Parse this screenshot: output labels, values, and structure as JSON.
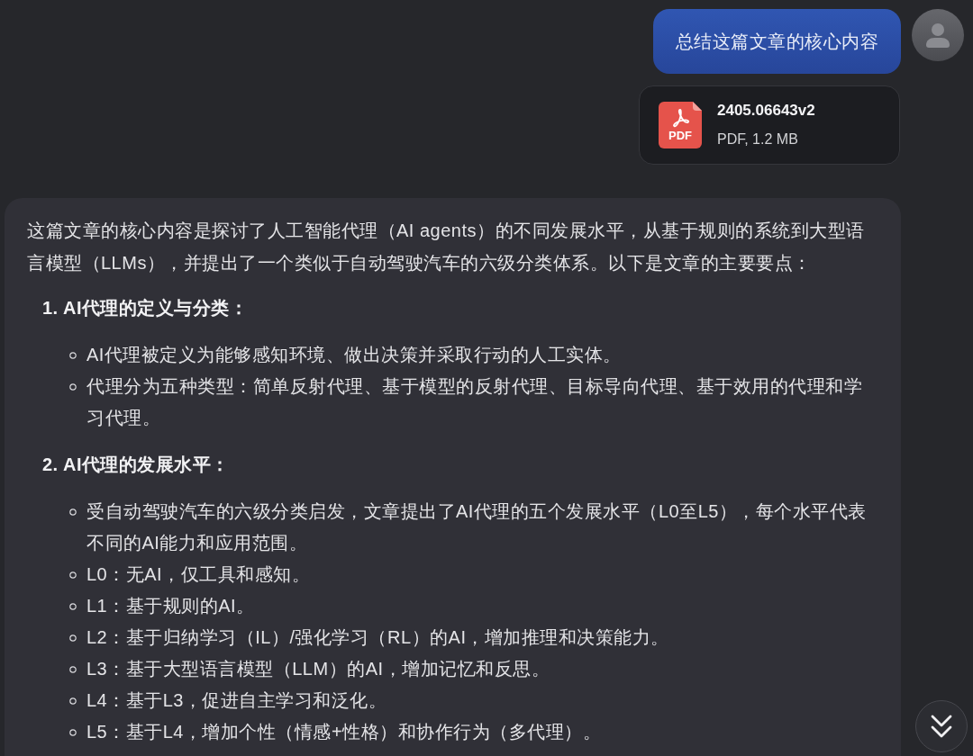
{
  "user_message": {
    "text": "总结这篇文章的核心内容"
  },
  "attachment": {
    "file_type_label": "PDF",
    "file_name": "2405.06643v2",
    "file_meta": "PDF, 1.2 MB"
  },
  "assistant_message": {
    "intro": "这篇文章的核心内容是探讨了人工智能代理（AI agents）的不同发展水平，从基于规则的系统到大型语言模型（LLMs），并提出了一个类似于自动驾驶汽车的六级分类体系。以下是文章的主要要点：",
    "sections": [
      {
        "heading": "1. AI代理的定义与分类：",
        "bullets": [
          "AI代理被定义为能够感知环境、做出决策并采取行动的人工实体。",
          "代理分为五种类型：简单反射代理、基于模型的反射代理、目标导向代理、基于效用的代理和学习代理。"
        ]
      },
      {
        "heading": "2. AI代理的发展水平：",
        "bullets": [
          "受自动驾驶汽车的六级分类启发，文章提出了AI代理的五个发展水平（L0至L5），每个水平代表不同的AI能力和应用范围。",
          "L0：无AI，仅工具和感知。",
          "L1：基于规则的AI。",
          "L2：基于归纳学习（IL）/强化学习（RL）的AI，增加推理和决策能力。",
          "L3：基于大型语言模型（LLM）的AI，增加记忆和反思。",
          "L4：基于L3，促进自主学习和泛化。",
          "L5：基于L4，增加个性（情感+性格）和协作行为（多代理）。"
        ]
      }
    ]
  }
}
